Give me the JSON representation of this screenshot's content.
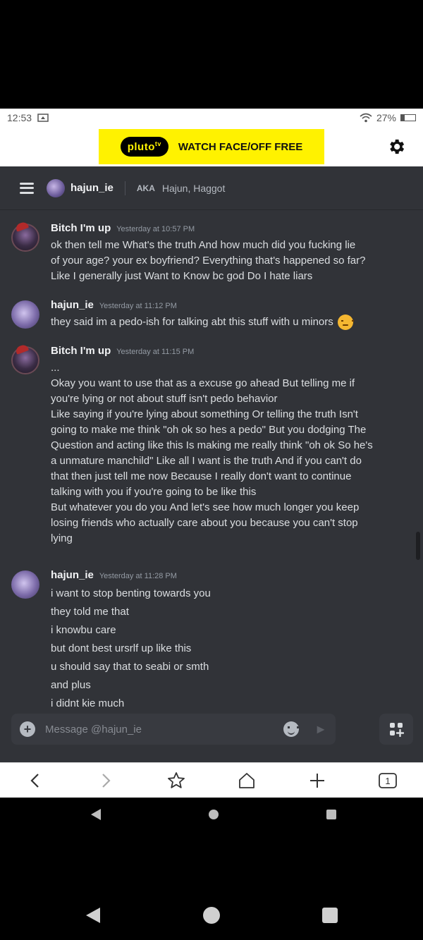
{
  "status_bar": {
    "time": "12:53",
    "battery": "27%",
    "battery_level": 0.27
  },
  "ad": {
    "logo": "pluto",
    "logo_sup": "tv",
    "text": "WATCH FACE/OFF FREE"
  },
  "header": {
    "username": "hajun_ie",
    "aka_label": "AKA",
    "aka_names": "Hajun, Haggot"
  },
  "messages": [
    {
      "author": "Bitch I'm up",
      "timestamp": "Yesterday at 10:57 PM",
      "lines": [
        "ok then tell me What's the truth And how much did you fucking lie",
        "of your age? your ex boyfriend? Everything that's happened so far?",
        "Like I generally just Want to Know bc god Do I hate liars"
      ]
    },
    {
      "author": "hajun_ie",
      "timestamp": "Yesterday at 11:12 PM",
      "lines": [
        "they said im a pedo-ish for talking abt this stuff with u minors"
      ]
    },
    {
      "author": "Bitch I'm up",
      "timestamp": "Yesterday at 11:15 PM",
      "lines": [
        "...",
        "Okay you want to use that as a excuse go ahead But telling me if",
        "you're lying or not about stuff isn't pedo behavior",
        "Like saying if you're lying about something Or telling the truth Isn't",
        "going to make me think \"oh ok so hes a pedo\" But you dodging The",
        "Question and acting like this Is making me really think \"oh ok So he's",
        "a unmature manchild\" Like all I want is the truth And if you can't do",
        "that then just tell me now Because I really don't want to continue",
        "talking with you if you're going to be like this",
        "But whatever you do you And let's see how much longer you keep",
        "losing friends who actually care about you because you can't stop",
        "lying"
      ]
    },
    {
      "author": "hajun_ie",
      "timestamp": "Yesterday at 11:28 PM",
      "lines": [
        "i want to stop benting towards you",
        "they told me that",
        "i knowbu care",
        "but dont best ursrlf up like this",
        "u should say that to seabi or smth",
        "and plus",
        "i didnt kie much"
      ]
    }
  ],
  "composer": {
    "placeholder": "Message @hajun_ie"
  },
  "browser_bar": {
    "tab_count": "1"
  }
}
